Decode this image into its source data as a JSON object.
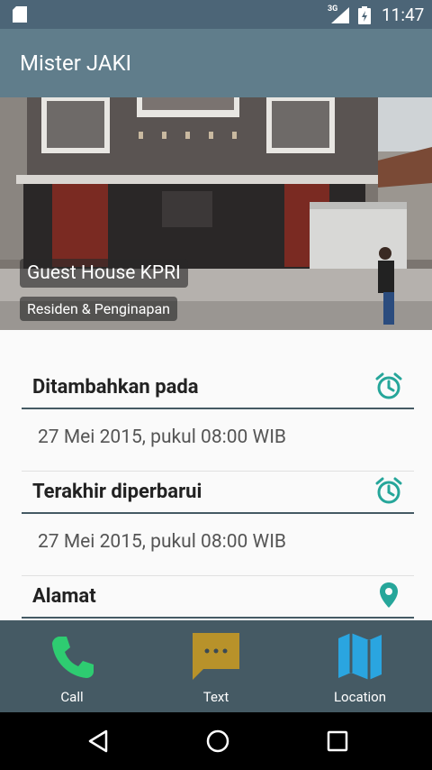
{
  "status": {
    "network": "3G",
    "time": "11:47"
  },
  "app": {
    "title": "Mister JAKI"
  },
  "place": {
    "name": "Guest House KPRI",
    "category": "Residen & Penginapan"
  },
  "details": [
    {
      "label": "Ditambahkan pada",
      "value": "27 Mei 2015, pukul 08:00 WIB",
      "icon": "alarm-clock-icon"
    },
    {
      "label": "Terakhir diperbarui",
      "value": "27 Mei 2015, pukul 08:00 WIB",
      "icon": "alarm-clock-icon"
    },
    {
      "label": "Alamat",
      "icon": "location-pin-icon"
    }
  ],
  "actions": [
    {
      "label": "Call",
      "icon": "phone-icon",
      "color": "#2ecc71"
    },
    {
      "label": "Text",
      "icon": "message-icon",
      "color": "#b8922a"
    },
    {
      "label": "Location",
      "icon": "map-icon",
      "color": "#2aa5e0"
    }
  ],
  "colors": {
    "primary": "#607d8b",
    "primary_dark": "#455a64",
    "accent": "#26a69a"
  }
}
